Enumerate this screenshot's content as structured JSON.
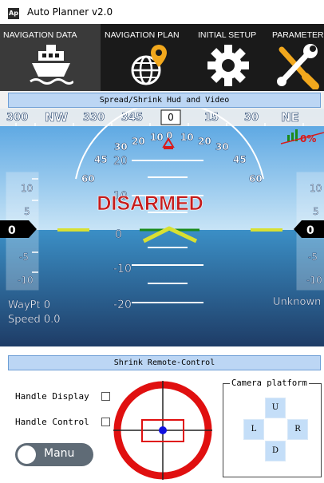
{
  "window": {
    "title": "Auto Planner v2.0",
    "app_icon": "Ap"
  },
  "tabs": [
    {
      "label": "NAVIGATION DATA",
      "icon": "boat-icon",
      "active": true
    },
    {
      "label": "NAVIGATION PLAN",
      "icon": "globe-pin-icon",
      "active": false
    },
    {
      "label": "INITIAL SETUP",
      "icon": "gear-icon",
      "active": false
    },
    {
      "label": "PARAMETER",
      "icon": "wrench-screwdriver-icon",
      "active": false
    }
  ],
  "hud_bar_label": "Spread/Shrink Hud and Video",
  "hud": {
    "heading_ticks": [
      "300",
      "NW",
      "330",
      "345",
      "0",
      "15",
      "30",
      "NE"
    ],
    "heading_value": "0",
    "pitch_labels": [
      "20",
      "10",
      "0",
      "-10",
      "-20"
    ],
    "roll_labels": [
      "60",
      "45",
      "30",
      "20",
      "10",
      "0",
      "10",
      "20",
      "30",
      "45",
      "60"
    ],
    "status": "DISARMED",
    "left_tape": {
      "ticks": [
        "10",
        "5",
        "-5",
        "-10"
      ],
      "value": "0"
    },
    "right_tape": {
      "ticks": [
        "10",
        "5",
        "-5",
        "-10"
      ],
      "value": "0"
    },
    "battery": "0%",
    "waypoint": "WayPt 0",
    "speed": "Speed 0.0",
    "mode": "Unknown",
    "colors": {
      "sky": "#87c3e8",
      "ground": "#3a8ec4",
      "status": "#c51c1c",
      "wings": "#d8e032",
      "horizon": "#1a8a1a"
    }
  },
  "remote_bar_label": "Shrink Remote-Control",
  "remote": {
    "handle_display_label": "Handle Display",
    "handle_control_label": "Handle Control",
    "handle_display_checked": false,
    "handle_control_checked": false,
    "toggle_label": "Manu",
    "camera_platform_label": "Camera platform",
    "dpad": {
      "up": "U",
      "left": "L",
      "right": "R",
      "down": "D"
    }
  }
}
